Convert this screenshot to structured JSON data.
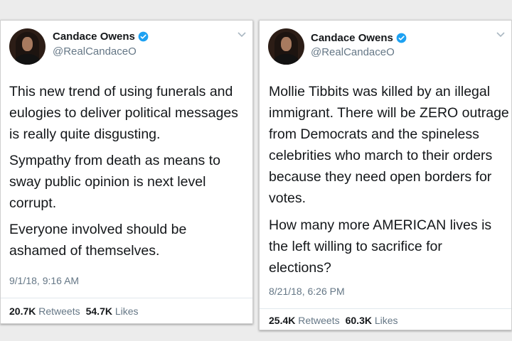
{
  "tweets": [
    {
      "author": {
        "name": "Candace Owens",
        "handle": "@RealCandaceO",
        "verified_icon": "verified-badge-icon"
      },
      "paragraphs": [
        [
          "This new trend of using funerals and",
          "eulogies to deliver political messages",
          "is really quite disgusting."
        ],
        [
          "Sympathy from death as means to",
          "sway public opinion is next level",
          "corrupt."
        ],
        [
          "Everyone involved should be",
          "ashamed of themselves."
        ]
      ],
      "timestamp": "9/1/18, 9:16 AM",
      "retweets_count": "20.7K",
      "retweets_label": "Retweets",
      "likes_count": "54.7K",
      "likes_label": "Likes"
    },
    {
      "author": {
        "name": "Candace Owens",
        "handle": "@RealCandaceO",
        "verified_icon": "verified-badge-icon"
      },
      "paragraphs": [
        [
          "Mollie Tibbits was killed by an illegal",
          "immigrant. There will be ZERO outrage",
          "from Democrats and the spineless",
          "celebrities who march to their orders",
          "because they need open borders for",
          "votes."
        ],
        [
          "How many more AMERICAN lives is",
          "the left willing to sacrifice for",
          "elections?"
        ]
      ],
      "timestamp": "8/21/18, 6:26 PM",
      "retweets_count": "25.4K",
      "retweets_label": "Retweets",
      "likes_count": "60.3K",
      "likes_label": "Likes"
    }
  ],
  "colors": {
    "verified_blue": "#1da1f2",
    "text": "#14171a",
    "secondary": "#657786",
    "background": "#ececec"
  }
}
